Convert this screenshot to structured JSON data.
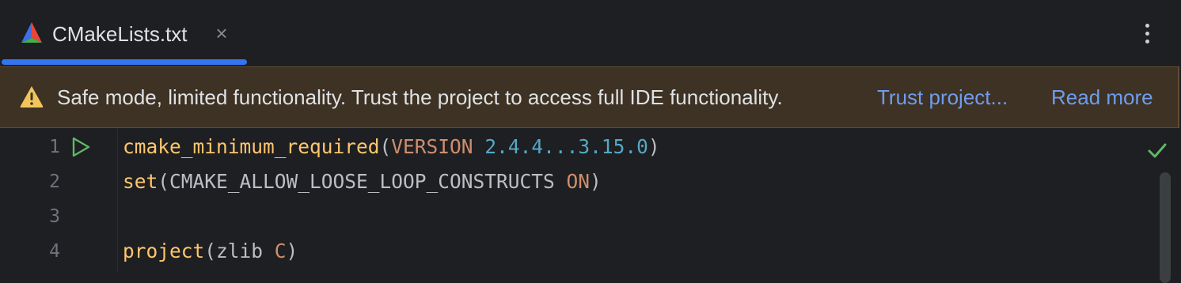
{
  "tab": {
    "title": "CMakeLists.txt",
    "close_glyph": "×",
    "icon": "cmake-icon"
  },
  "more_menu": {
    "icon": "more-vertical-icon"
  },
  "banner": {
    "icon": "warning-icon",
    "message": "Safe mode, limited functionality. Trust the project to access full IDE functionality.",
    "trust_link": "Trust project...",
    "read_more_link": "Read more"
  },
  "editor": {
    "lines": [
      {
        "number": "1",
        "tokens": [
          {
            "t": "cmake_minimum_required",
            "c": "kw"
          },
          {
            "t": "(",
            "c": "plain"
          },
          {
            "t": "VERSION",
            "c": "const"
          },
          {
            "t": " ",
            "c": "plain"
          },
          {
            "t": "2.4.4...3.15.0",
            "c": "num"
          },
          {
            "t": ")",
            "c": "plain"
          }
        ]
      },
      {
        "number": "2",
        "tokens": [
          {
            "t": "set",
            "c": "kw"
          },
          {
            "t": "(CMAKE_ALLOW_LOOSE_LOOP_CONSTRUCTS ",
            "c": "plain"
          },
          {
            "t": "ON",
            "c": "const"
          },
          {
            "t": ")",
            "c": "plain"
          }
        ]
      },
      {
        "number": "3",
        "tokens": []
      },
      {
        "number": "4",
        "tokens": [
          {
            "t": "project",
            "c": "kw"
          },
          {
            "t": "(zlib ",
            "c": "plain"
          },
          {
            "t": "C",
            "c": "const"
          },
          {
            "t": ")",
            "c": "plain"
          }
        ]
      }
    ],
    "run_icon": "run-icon",
    "status_icon": "check-icon"
  },
  "colors": {
    "accent": "#3574f0",
    "banner_bg": "#3d3223",
    "link": "#6f9cf0",
    "keyword": "#ffc66d",
    "constant": "#cf8e6d",
    "number": "#56a8c4"
  }
}
